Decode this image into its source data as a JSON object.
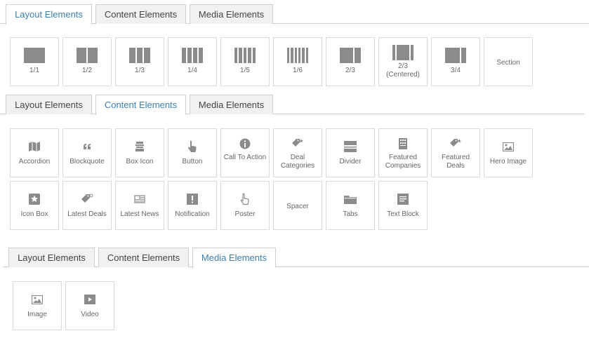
{
  "tabs": {
    "layout": "Layout Elements",
    "content": "Content Elements",
    "media": "Media Elements"
  },
  "layout_items": [
    {
      "label": "1/1",
      "icon": "layout-1-1-icon"
    },
    {
      "label": "1/2",
      "icon": "layout-1-2-icon"
    },
    {
      "label": "1/3",
      "icon": "layout-1-3-icon"
    },
    {
      "label": "1/4",
      "icon": "layout-1-4-icon"
    },
    {
      "label": "1/5",
      "icon": "layout-1-5-icon"
    },
    {
      "label": "1/6",
      "icon": "layout-1-6-icon"
    },
    {
      "label": "2/3",
      "icon": "layout-2-3-icon"
    },
    {
      "label": "2/3 (Centered)",
      "icon": "layout-2-3-centered-icon"
    },
    {
      "label": "3/4",
      "icon": "layout-3-4-icon"
    },
    {
      "label": "Section",
      "icon": ""
    }
  ],
  "content_items": [
    {
      "label": "Accordion",
      "icon": "map-icon"
    },
    {
      "label": "Blockquote",
      "icon": "quote-icon"
    },
    {
      "label": "Box Icon",
      "icon": "box-icon"
    },
    {
      "label": "Button",
      "icon": "hand-pointer-icon"
    },
    {
      "label": "Call To Action",
      "icon": "info-icon"
    },
    {
      "label": "Deal Categories",
      "icon": "tag-star-icon"
    },
    {
      "label": "Divider",
      "icon": "divider-icon"
    },
    {
      "label": "Featured Companies",
      "icon": "building-icon"
    },
    {
      "label": "Featured Deals",
      "icon": "tag-star-icon"
    },
    {
      "label": "Hero Image",
      "icon": "image-icon"
    },
    {
      "label": "Icon Box",
      "icon": "star-box-icon"
    },
    {
      "label": "Latest Deals",
      "icon": "tag-icon"
    },
    {
      "label": "Latest News",
      "icon": "newspaper-icon"
    },
    {
      "label": "Notification",
      "icon": "alert-icon"
    },
    {
      "label": "Poster",
      "icon": "hand-pointer-outline-icon"
    },
    {
      "label": "Spacer",
      "icon": ""
    },
    {
      "label": "Tabs",
      "icon": "folder-icon"
    },
    {
      "label": "Text Block",
      "icon": "text-block-icon"
    }
  ],
  "media_items": [
    {
      "label": "Image",
      "icon": "image-icon"
    },
    {
      "label": "Video",
      "icon": "video-icon"
    }
  ],
  "colors": {
    "active_tab_text": "#3c7fb1",
    "icon_gray": "#8b8b8b",
    "border": "#dadada"
  }
}
